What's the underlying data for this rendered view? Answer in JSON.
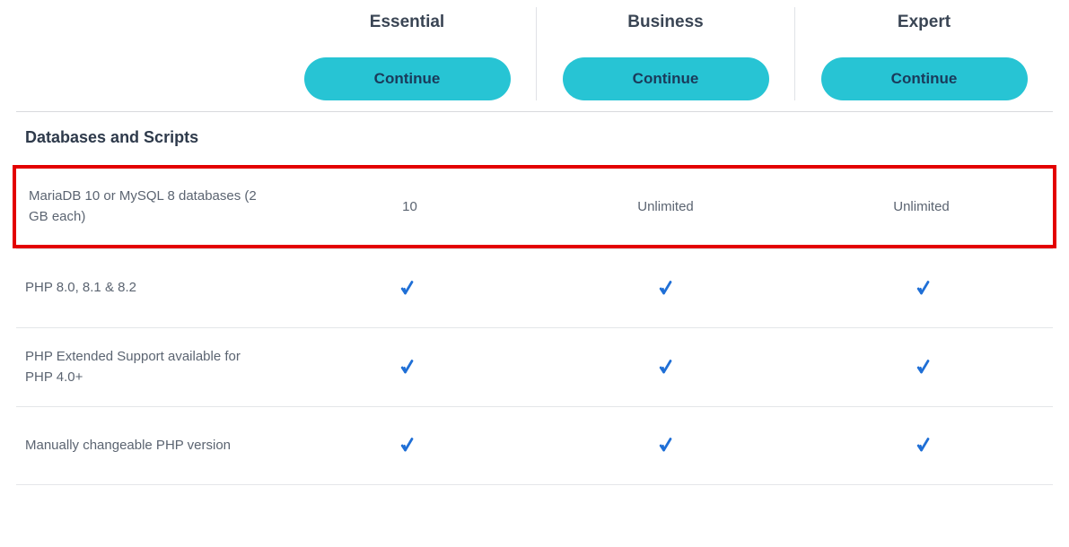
{
  "plans": [
    {
      "name": "Essential",
      "cta": "Continue"
    },
    {
      "name": "Business",
      "cta": "Continue"
    },
    {
      "name": "Expert",
      "cta": "Continue"
    }
  ],
  "section_title": "Databases and Scripts",
  "rows": [
    {
      "label": "MariaDB 10 or MySQL 8 databases (2 GB each)",
      "values": [
        "10",
        "Unlimited",
        "Unlimited"
      ],
      "checks": [
        false,
        false,
        false
      ],
      "highlighted": true
    },
    {
      "label": "PHP 8.0, 8.1 & 8.2",
      "values": [
        "",
        "",
        ""
      ],
      "checks": [
        true,
        true,
        true
      ],
      "highlighted": false
    },
    {
      "label": "PHP Extended Support available for PHP 4.0+",
      "values": [
        "",
        "",
        ""
      ],
      "checks": [
        true,
        true,
        true
      ],
      "highlighted": false
    },
    {
      "label": "Manually changeable PHP version",
      "values": [
        "",
        "",
        ""
      ],
      "checks": [
        true,
        true,
        true
      ],
      "highlighted": false
    }
  ]
}
